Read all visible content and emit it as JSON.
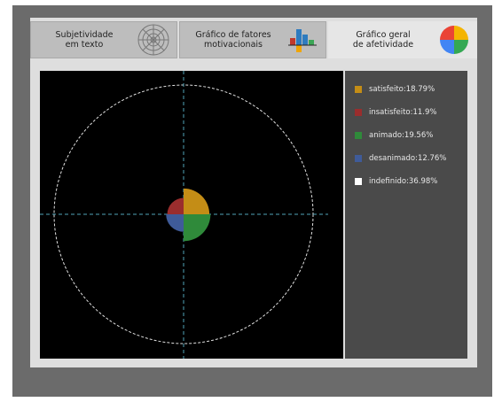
{
  "tabs": [
    {
      "label_line1": "Subjetividade",
      "label_line2": "em texto",
      "icon": "radar-target-icon",
      "active": false
    },
    {
      "label_line1": "Gráfico de fatores",
      "label_line2": "motivacionais",
      "icon": "bar-chart-icon",
      "active": false
    },
    {
      "label_line1": "Gráfico geral",
      "label_line2": "de afetividade",
      "icon": "pie-chart-icon",
      "active": true
    }
  ],
  "legend": [
    {
      "label": "satisfeito:18.79%",
      "color": "#c48d16"
    },
    {
      "label": "insatisfeito:11.9%",
      "color": "#9a2d2d"
    },
    {
      "label": "animado:19.56%",
      "color": "#2f8a3a"
    },
    {
      "label": "desanimado:12.76%",
      "color": "#3f5b99"
    },
    {
      "label": "indefinido:36.98%",
      "color": "#ffffff"
    }
  ],
  "chart_data": {
    "type": "pie",
    "series": [
      {
        "name": "satisfeito",
        "value": 18.79,
        "color": "#c48d16"
      },
      {
        "name": "insatisfeito",
        "value": 11.9,
        "color": "#9a2d2d"
      },
      {
        "name": "animado",
        "value": 19.56,
        "color": "#2f8a3a"
      },
      {
        "name": "desanimado",
        "value": 12.76,
        "color": "#3f5b99"
      },
      {
        "name": "indefinido",
        "value": 36.98,
        "color": "#ffffff"
      }
    ],
    "quadrant_order": [
      "satisfeito",
      "animado",
      "desanimado",
      "insatisfeito"
    ],
    "outer_circle": "dashed white",
    "axes": "dashed cyan crosshair"
  }
}
